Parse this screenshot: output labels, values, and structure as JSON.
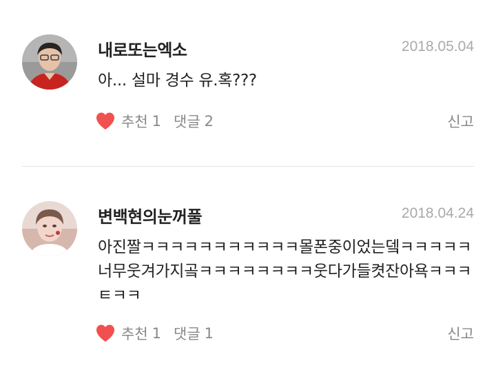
{
  "comments": [
    {
      "username": "내로또는엑소",
      "date": "2018.05.04",
      "text": "아... 설마 경수 유.혹???",
      "like_label": "추천",
      "like_count": "1",
      "reply_label": "댓글",
      "reply_count": "2",
      "report_label": "신고",
      "avatar_icon": "user-avatar-icon"
    },
    {
      "username": "변백현의눈꺼풀",
      "date": "2018.04.24",
      "text": "아진짤ㅋㅋㅋㅋㅋㅋㅋㅋㅋㅋㅋ몰폰중이었는뎈ㅋㅋㅋㅋㅋ너무웃겨가지곸ㅋㅋㅋㅋㅋㅋㅋㅋ웃다가들켯잔아욕ㅋㅋㅋㅌㅋㅋ",
      "like_label": "추천",
      "like_count": "1",
      "reply_label": "댓글",
      "reply_count": "1",
      "report_label": "신고",
      "avatar_icon": "user-avatar-icon"
    }
  ],
  "colors": {
    "heart": "#f0504f",
    "date": "#a9a9a9",
    "muted": "#888888",
    "divider": "#e4e4e4",
    "text": "#222222"
  }
}
